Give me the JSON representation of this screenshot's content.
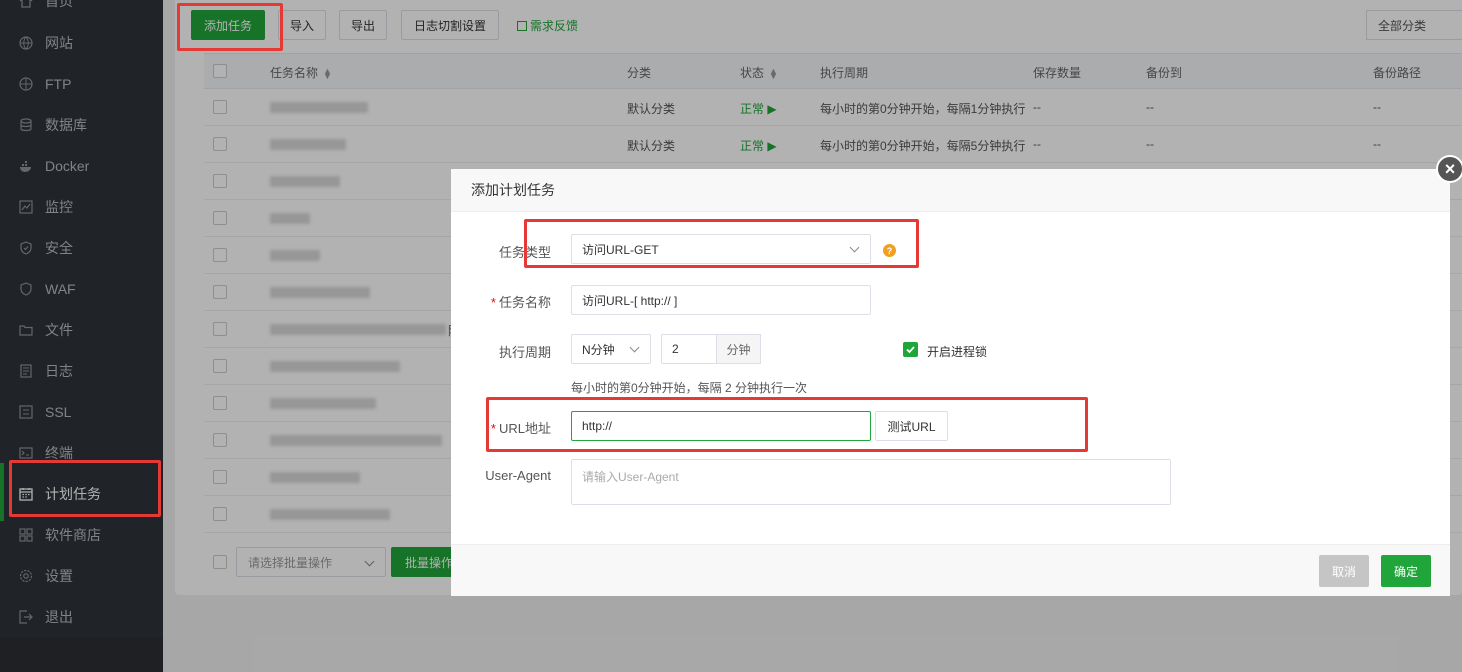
{
  "sidebar": {
    "items": [
      {
        "label": "首页",
        "icon": "home-icon"
      },
      {
        "label": "网站",
        "icon": "globe-icon"
      },
      {
        "label": "FTP",
        "icon": "ftp-icon"
      },
      {
        "label": "数据库",
        "icon": "database-icon"
      },
      {
        "label": "Docker",
        "icon": "docker-icon"
      },
      {
        "label": "监控",
        "icon": "monitor-icon"
      },
      {
        "label": "安全",
        "icon": "shield-icon"
      },
      {
        "label": "WAF",
        "icon": "waf-icon"
      },
      {
        "label": "文件",
        "icon": "folder-icon"
      },
      {
        "label": "日志",
        "icon": "log-icon"
      },
      {
        "label": "SSL",
        "icon": "ssl-icon"
      },
      {
        "label": "终端",
        "icon": "terminal-icon"
      },
      {
        "label": "计划任务",
        "icon": "calendar-icon",
        "active": true
      },
      {
        "label": "软件商店",
        "icon": "grid-icon"
      },
      {
        "label": "设置",
        "icon": "gear-icon"
      },
      {
        "label": "退出",
        "icon": "logout-icon"
      }
    ]
  },
  "toolbar": {
    "add_label": "添加任务",
    "import_label": "导入",
    "export_label": "导出",
    "log_cut_label": "日志切割设置",
    "feedback_label": "需求反馈",
    "category_label": "全部分类"
  },
  "table": {
    "headers": {
      "name": "任务名称",
      "category": "分类",
      "status": "状态",
      "cycle": "执行周期",
      "save_count": "保存数量",
      "backup_to": "备份到",
      "backup_path": "备份路径"
    },
    "rows": [
      {
        "category": "默认分类",
        "status": "正常 ▶",
        "cycle": "每小时的第0分钟开始，每隔1分钟执行",
        "save_count": "--",
        "backup_to": "--",
        "backup_path": "--"
      },
      {
        "category": "默认分类",
        "status": "正常 ▶",
        "cycle": "每小时的第0分钟开始，每隔5分钟执行",
        "save_count": "--",
        "backup_to": "--",
        "backup_path": "--"
      }
    ],
    "row6_suffix": "除"
  },
  "footer": {
    "batch_placeholder": "请选择批量操作",
    "batch_button": "批量操作"
  },
  "modal": {
    "title": "添加计划任务",
    "task_type_label": "任务类型",
    "task_type_value": "访问URL-GET",
    "help_glyph": "?",
    "name_label": "任务名称",
    "name_value": "访问URL-[ http:// ]",
    "cycle_label": "执行周期",
    "cycle_unit_select": "N分钟",
    "cycle_value": "2",
    "cycle_unit": "分钟",
    "lock_label": "开启进程锁",
    "cycle_hint": "每小时的第0分钟开始，每隔 2 分钟执行一次",
    "url_label": "URL地址",
    "url_value": "http://",
    "test_url_label": "测试URL",
    "ua_label": "User-Agent",
    "ua_placeholder": "请输入User-Agent",
    "cancel_label": "取消",
    "confirm_label": "确定",
    "close_glyph": "×"
  }
}
